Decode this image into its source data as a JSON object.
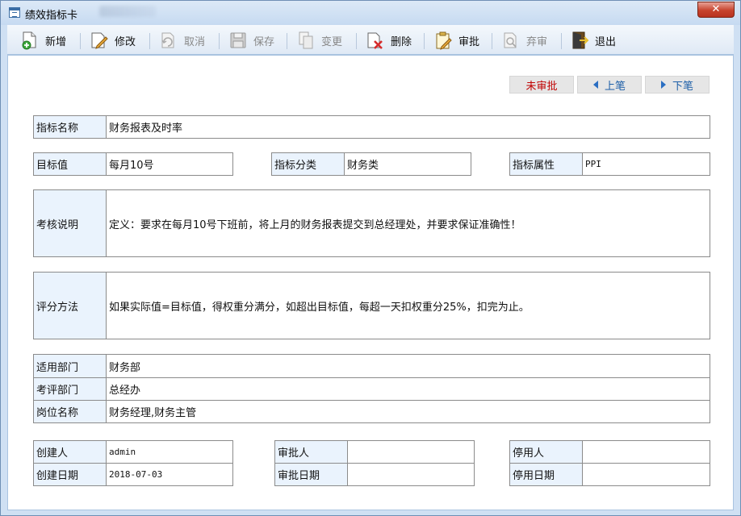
{
  "window": {
    "title": "绩效指标卡",
    "close_label": "✕"
  },
  "toolbar": {
    "new": "新增",
    "edit": "修改",
    "cancel": "取消",
    "save": "保存",
    "change": "变更",
    "delete": "删除",
    "approve": "审批",
    "abandon": "弃审",
    "exit": "退出"
  },
  "status": {
    "approval_state": "未审批",
    "prev": "上笔",
    "next": "下笔"
  },
  "form": {
    "indicator_name": {
      "label": "指标名称",
      "value": "财务报表及时率"
    },
    "target_value": {
      "label": "目标值",
      "value": "每月10号"
    },
    "category": {
      "label": "指标分类",
      "value": "财务类"
    },
    "attribute": {
      "label": "指标属性",
      "value": "PPI"
    },
    "assessment": {
      "label": "考核说明",
      "value": "定义：要求在每月10号下班前，将上月的财务报表提交到总经理处，并要求保证准确性！"
    },
    "scoring": {
      "label": "评分方法",
      "value": "如果实际值=目标值，得权重分满分，如超出目标值，每超一天扣权重分25%，扣完为止。"
    },
    "applicable_dept": {
      "label": "适用部门",
      "value": "财务部"
    },
    "review_dept": {
      "label": "考评部门",
      "value": "总经办"
    },
    "position": {
      "label": "岗位名称",
      "value": "财务经理,财务主管"
    },
    "creator": {
      "label": "创建人",
      "value": "admin"
    },
    "created_date": {
      "label": "创建日期",
      "value": "2018-07-03"
    },
    "approver": {
      "label": "审批人",
      "value": ""
    },
    "approved_date": {
      "label": "审批日期",
      "value": ""
    },
    "disabler": {
      "label": "停用人",
      "value": ""
    },
    "disabled_date": {
      "label": "停用日期",
      "value": ""
    }
  }
}
